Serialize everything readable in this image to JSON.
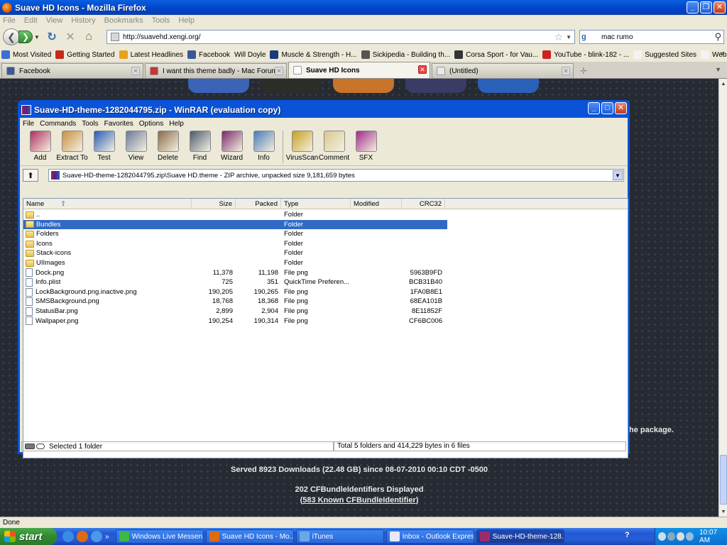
{
  "firefox": {
    "title": "Suave HD Icons - Mozilla Firefox",
    "menu": [
      "File",
      "Edit",
      "View",
      "History",
      "Bookmarks",
      "Tools",
      "Help"
    ],
    "url": "http://suavehd.xengi.org/",
    "search_value": "mac rumo",
    "bookmarks": [
      {
        "label": "Most Visited",
        "color": "#3b6fd0"
      },
      {
        "label": "Getting Started",
        "color": "#c62a1a"
      },
      {
        "label": "Latest Headlines",
        "color": "#e8a020"
      },
      {
        "label": "Facebook",
        "color": "#3b5998"
      },
      {
        "label": "Will Doyle",
        "color": ""
      },
      {
        "label": "Muscle & Strength - H...",
        "color": "#1a3a7a"
      },
      {
        "label": "Sickipedia - Building th...",
        "color": "#555555"
      },
      {
        "label": "Corsa Sport - for Vau...",
        "color": "#333333"
      },
      {
        "label": "YouTube - blink-182 - ...",
        "color": "#cc2222"
      },
      {
        "label": "Suggested Sites",
        "color": "#f3f3f3"
      },
      {
        "label": "Web Slice Gallery",
        "color": "#f3f3f3"
      }
    ],
    "bookmarks_more": "»",
    "tabs": [
      {
        "label": "Facebook",
        "color": "#3b5998",
        "active": false
      },
      {
        "label": "I want this theme badly - Mac Forums",
        "color": "#cc3333",
        "active": false
      },
      {
        "label": "Suave HD Icons",
        "color": "#ffffff",
        "active": true
      },
      {
        "label": "(Untitled)",
        "color": "#e8e8e8",
        "active": false
      }
    ],
    "status": "Done"
  },
  "page": {
    "note_fragment": "he package.",
    "served": "Served 8923 Downloads (22.48 GB) since 08-07-2010 00:10 CDT -0500",
    "cfb_displayed": "202 CFBundleIdentifiers Displayed",
    "known_open": "(",
    "known_link": "583 Known CFBundleIdentifier",
    "known_close": ")",
    "dock_icon_colors": [
      "#3b63b8",
      "#2a2e26",
      "#c8742a",
      "#3a3c66",
      "#2a60b8"
    ]
  },
  "winrar": {
    "title": "Suave-HD-theme-1282044795.zip - WinRAR (evaluation copy)",
    "menu": [
      "File",
      "Commands",
      "Tools",
      "Favorites",
      "Options",
      "Help"
    ],
    "toolbar": [
      {
        "label": "Add",
        "color": "#b03060"
      },
      {
        "label": "Extract To",
        "color": "#c89040"
      },
      {
        "label": "Test",
        "color": "#2a5ab8"
      },
      {
        "label": "View",
        "color": "#6a7a9a"
      },
      {
        "label": "Delete",
        "color": "#8a6a4a"
      },
      {
        "label": "Find",
        "color": "#4a5a6a"
      },
      {
        "label": "Wizard",
        "color": "#7a2a6a"
      },
      {
        "label": "Info",
        "color": "#4a7ab8"
      }
    ],
    "toolbar2": [
      {
        "label": "VirusScan",
        "color": "#c8a020"
      },
      {
        "label": "Comment",
        "color": "#d8c890"
      },
      {
        "label": "SFX",
        "color": "#a02a8a"
      }
    ],
    "path": "Suave-HD-theme-1282044795.zip\\Suave HD.theme - ZIP archive, unpacked size 9,181,659 bytes",
    "columns": [
      "Name",
      "Size",
      "Packed",
      "Type",
      "Modified",
      "CRC32"
    ],
    "files": [
      {
        "name": "..",
        "size": "",
        "packed": "",
        "type": "Folder",
        "modified": "",
        "crc": "",
        "kind": "folder"
      },
      {
        "name": "Bundles",
        "size": "",
        "packed": "",
        "type": "Folder",
        "modified": "",
        "crc": "",
        "kind": "folder"
      },
      {
        "name": "Folders",
        "size": "",
        "packed": "",
        "type": "Folder",
        "modified": "",
        "crc": "",
        "kind": "folder"
      },
      {
        "name": "Icons",
        "size": "",
        "packed": "",
        "type": "Folder",
        "modified": "",
        "crc": "",
        "kind": "folder"
      },
      {
        "name": "Stack-icons",
        "size": "",
        "packed": "",
        "type": "Folder",
        "modified": "",
        "crc": "",
        "kind": "folder"
      },
      {
        "name": "UIImages",
        "size": "",
        "packed": "",
        "type": "Folder",
        "modified": "",
        "crc": "",
        "kind": "folder"
      },
      {
        "name": "Dock.png",
        "size": "11,378",
        "packed": "11,198",
        "type": "File png",
        "modified": "",
        "crc": "5963B9FD",
        "kind": "file"
      },
      {
        "name": "Info.plist",
        "size": "725",
        "packed": "351",
        "type": "QuickTime Preferen...",
        "modified": "",
        "crc": "BCB31B40",
        "kind": "file"
      },
      {
        "name": "LockBackground.png.inactive.png",
        "size": "190,205",
        "packed": "190,265",
        "type": "File png",
        "modified": "",
        "crc": "1FA0B8E1",
        "kind": "file"
      },
      {
        "name": "SMSBackground.png",
        "size": "18,768",
        "packed": "18,368",
        "type": "File png",
        "modified": "",
        "crc": "68EA101B",
        "kind": "file"
      },
      {
        "name": "StatusBar.png",
        "size": "2,899",
        "packed": "2,904",
        "type": "File png",
        "modified": "",
        "crc": "8E11852F",
        "kind": "file"
      },
      {
        "name": "Wallpaper.png",
        "size": "190,254",
        "packed": "190,314",
        "type": "File png",
        "modified": "",
        "crc": "CF6BC006",
        "kind": "file"
      }
    ],
    "selected_index": 1,
    "status_left": "Selected 1 folder",
    "status_right": "Total 5 folders and 414,229 bytes in 6 files"
  },
  "taskbar": {
    "start": "start",
    "tasks": [
      {
        "label": "Windows Live Messen...",
        "color": "#3ab848",
        "active": false
      },
      {
        "label": "Suave HD Icons - Mo...",
        "color": "#e06a10",
        "active": false
      },
      {
        "label": "iTunes",
        "color": "#6aa8e8",
        "active": false
      },
      {
        "label": "Inbox - Outlook Express",
        "color": "#e8e8f8",
        "active": false
      },
      {
        "label": "Suave-HD-theme-128...",
        "color": "#a02a6a",
        "active": true
      }
    ],
    "clock": "10:07 AM"
  }
}
